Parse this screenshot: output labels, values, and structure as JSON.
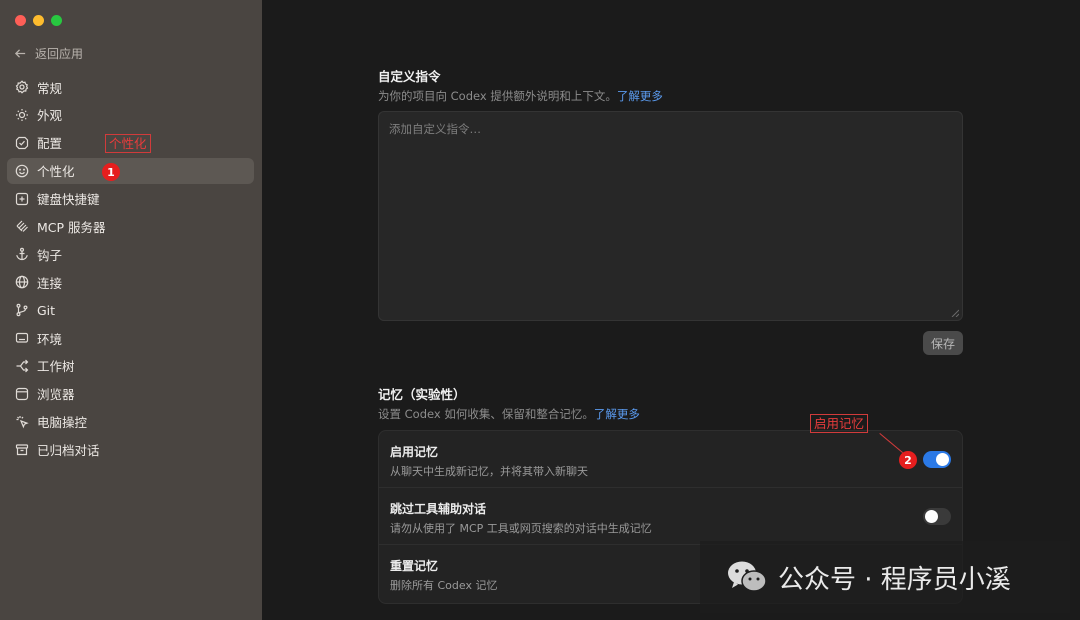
{
  "sidebar": {
    "back_label": "返回应用",
    "items": [
      {
        "label": "常规",
        "icon": "gear-icon"
      },
      {
        "label": "外观",
        "icon": "sun-icon"
      },
      {
        "label": "配置",
        "icon": "config-icon"
      },
      {
        "label": "个性化",
        "icon": "smile-icon",
        "active": true
      },
      {
        "label": "键盘快捷键",
        "icon": "keyboard-icon"
      },
      {
        "label": "MCP 服务器",
        "icon": "mcp-icon"
      },
      {
        "label": "钩子",
        "icon": "anchor-icon"
      },
      {
        "label": "连接",
        "icon": "globe-icon"
      },
      {
        "label": "Git",
        "icon": "git-branch-icon"
      },
      {
        "label": "环境",
        "icon": "monitor-icon"
      },
      {
        "label": "工作树",
        "icon": "worktree-icon"
      },
      {
        "label": "浏览器",
        "icon": "browser-icon"
      },
      {
        "label": "电脑操控",
        "icon": "cursor-click-icon"
      },
      {
        "label": "已归档对话",
        "icon": "archive-icon"
      }
    ]
  },
  "custom_instructions": {
    "title": "自定义指令",
    "desc": "为你的项目向 Codex 提供额外说明和上下文。",
    "link": "了解更多",
    "placeholder": "添加自定义指令…",
    "save_label": "保存"
  },
  "memory": {
    "title": "记忆（实验性）",
    "desc": "设置 Codex 如何收集、保留和整合记忆。",
    "link": "了解更多",
    "rows": [
      {
        "title": "启用记忆",
        "desc": "从聊天中生成新记忆，并将其带入新聊天",
        "enabled": true
      },
      {
        "title": "跳过工具辅助对话",
        "desc": "请勿从使用了 MCP 工具或网页搜索的对话中生成记忆",
        "enabled": false
      },
      {
        "title": "重置记忆",
        "desc": "删除所有 Codex 记忆"
      }
    ]
  },
  "annotations": {
    "a1": {
      "label": "个性化",
      "number": "1"
    },
    "a2": {
      "label": "启用记忆",
      "number": "2"
    }
  },
  "watermark": {
    "text": "公众号 · 程序员小溪"
  },
  "colors": {
    "accent": "#2b79e6",
    "link": "#5b9bef",
    "annotation": "#e61e1e"
  }
}
